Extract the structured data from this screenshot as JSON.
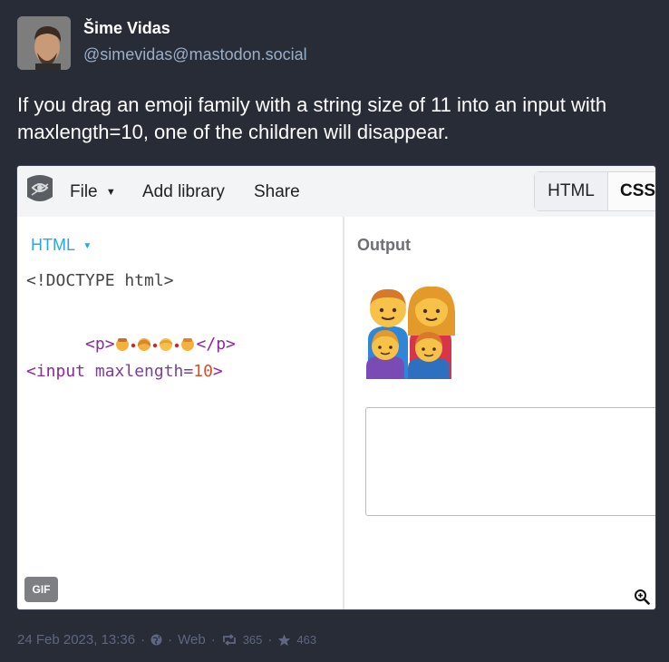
{
  "account": {
    "display_name": "Šime Vidas",
    "handle": "@simevidas@mastodon.social"
  },
  "status": {
    "text": "If you drag an emoji family with a string size of 11 into an input with maxlength=10, one of the children will disappear."
  },
  "media": {
    "toolbar": {
      "file_label": "File",
      "add_library_label": "Add library",
      "share_label": "Share",
      "tab_html": "HTML",
      "tab_css": "CSS"
    },
    "editor": {
      "language": "HTML",
      "line1": "<!DOCTYPE html>",
      "line2_open": "<p>",
      "line2_close": "</p>",
      "line3_tag": "<input ",
      "line3_attr": "maxlength=",
      "line3_value": "10",
      "line3_end": ">"
    },
    "output": {
      "label": "Output"
    },
    "gif_badge": "GIF"
  },
  "meta": {
    "date": "24 Feb 2023, 13:36",
    "visibility_icon": "globe-icon",
    "app": "Web",
    "boost_count": "365",
    "favourite_count": "463"
  },
  "colors": {
    "background": "#282c37",
    "secondary_text": "#9baec8",
    "meta_text": "#5e6681",
    "jsfiddle_blue": "#2aa7e0"
  }
}
